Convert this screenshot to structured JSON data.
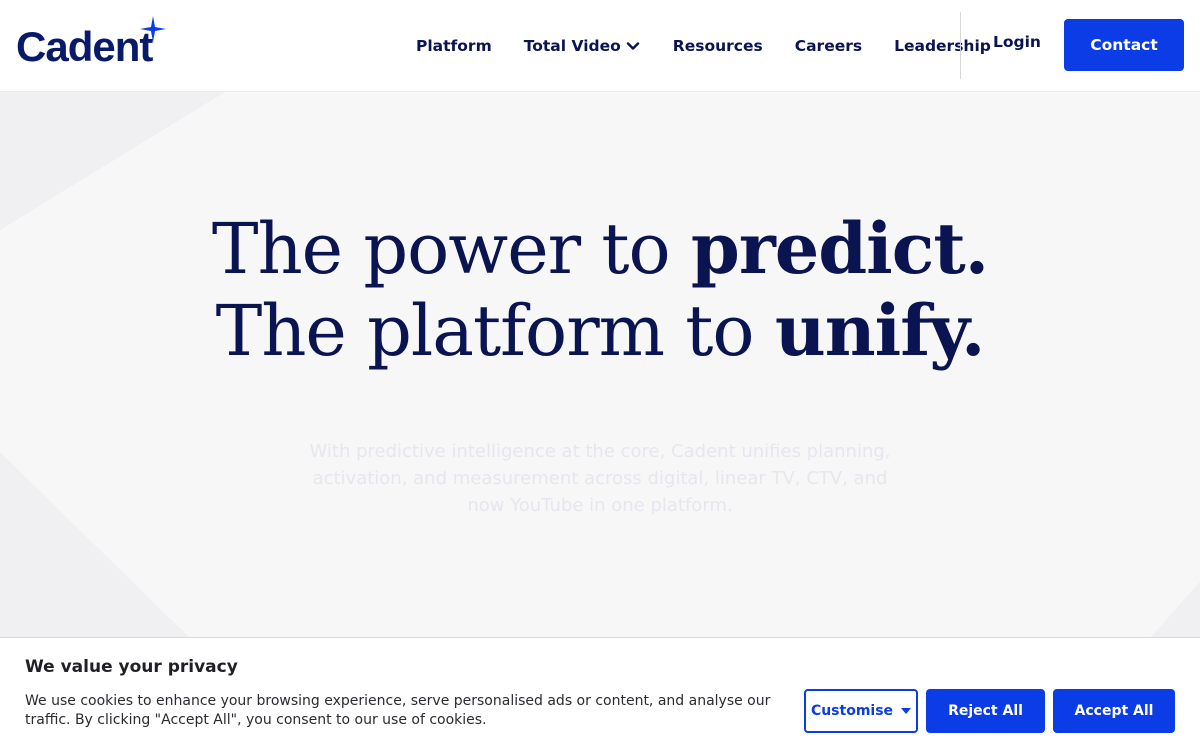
{
  "brand": {
    "logo_text": "Cadent",
    "accent_color": "#0b3ce6",
    "navy_color": "#0a1450"
  },
  "nav": {
    "items": [
      {
        "label": "Platform",
        "has_dropdown": false
      },
      {
        "label": "Total Video",
        "has_dropdown": true
      },
      {
        "label": "Resources",
        "has_dropdown": false
      },
      {
        "label": "Careers",
        "has_dropdown": false
      },
      {
        "label": "Leadership",
        "has_dropdown": false
      }
    ],
    "login_label": "Login",
    "contact_label": "Contact"
  },
  "hero": {
    "line1_regular": "The power to ",
    "line1_bold": "predict.",
    "line2_regular": "The platform to ",
    "line2_bold": "unify.",
    "subtext": "With predictive intelligence at the core, Cadent unifies planning, activation, and measurement across digital, linear TV, CTV, and now YouTube in one platform."
  },
  "cookie_banner": {
    "title": "We value your privacy",
    "body": "We use cookies to enhance your browsing experience, serve personalised ads or content, and analyse our traffic. By clicking \"Accept All\", you consent to our use of cookies.",
    "customise_label": "Customise",
    "reject_label": "Reject All",
    "accept_label": "Accept All"
  }
}
